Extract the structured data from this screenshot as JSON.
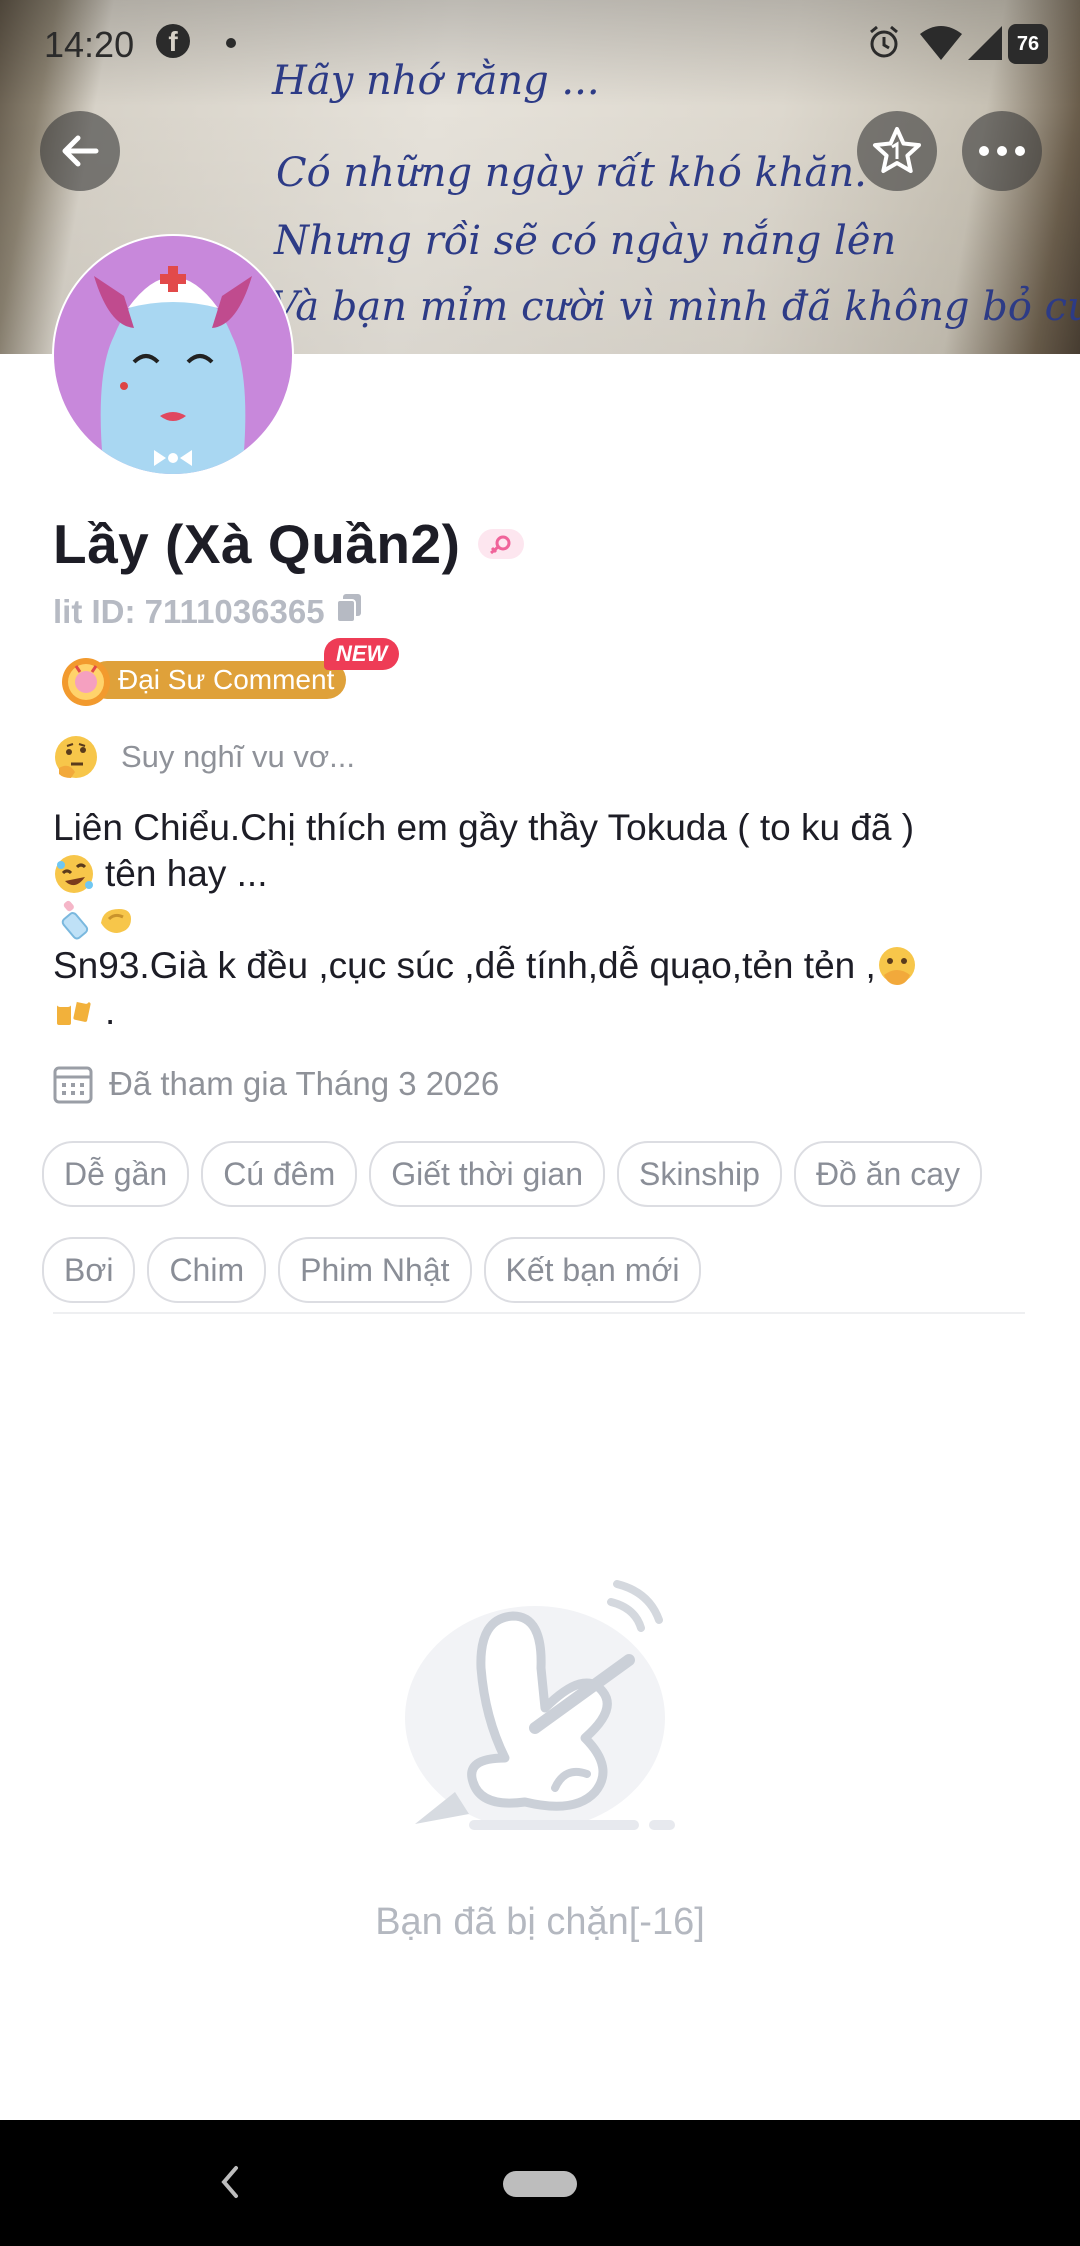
{
  "status_bar": {
    "time": "14:20",
    "battery": "76",
    "icons": [
      "facebook-icon",
      "notification-dot",
      "alarm-icon",
      "wifi-icon",
      "signal-icon",
      "battery-icon"
    ]
  },
  "cover": {
    "lines": [
      "Hãy nhớ rằng ...",
      "Có những ngày rất khó khăn.",
      "Nhưng rồi sẽ có ngày nắng lên",
      "Và bạn mỉm cười vì mình đã không bỏ cuộc"
    ]
  },
  "header_buttons": [
    "back-icon",
    "star-icon",
    "more-icon"
  ],
  "profile": {
    "name": "Lầy (Xà Quần2)",
    "gender_icon": "female-icon",
    "lit_id": "lit ID: 7111036365",
    "badge_label": "Đại Sư Comment",
    "badge_new": "NEW",
    "mood": "Suy nghĩ vu vơ...",
    "bio_line1": "Liên Chiểu.Chị thích em gầy thầy Tokuda ( to ku đã  )",
    "bio_line2": "tên hay ...",
    "bio_line4": " Sn93.Già k đều ,cục súc ,dễ tính,dễ quạo,tẻn tẻn ,",
    "bio_line5": ".",
    "joined": "Đã tham gia Tháng 3 2026"
  },
  "tags_row1": [
    "Dễ gần",
    "Cú đêm",
    "Giết thời gian",
    "Skinship",
    "Đồ ăn cay"
  ],
  "tags_row2": [
    "Bơi",
    "Chim",
    "Phim Nhật",
    "Kết bạn mới"
  ],
  "empty_state": {
    "illustration": "blocked-rabbit-illustration",
    "message": "Bạn đã bị chặn[-16]"
  },
  "colors": {
    "badge": "#dfa13a",
    "new_badge": "#ee3c56",
    "avatar_bg": "#c888db",
    "tag_text": "#8a8e97",
    "muted_text": "#b4b8c0"
  }
}
